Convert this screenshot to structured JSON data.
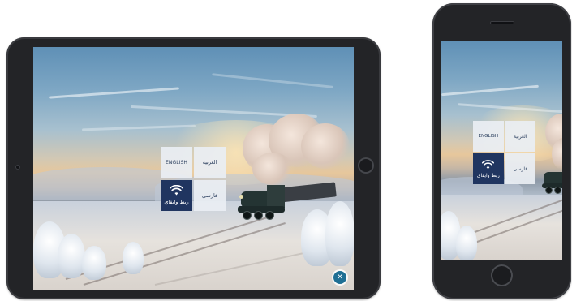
{
  "language_menu": {
    "english_label": "ENGLISH",
    "arabic_label": "العربية",
    "wifi_label": "ربط وايفاي",
    "farsi_label": "فارسی"
  },
  "icons": {
    "wifi": "wifi-icon",
    "close": "close-icon",
    "close_glyph": "✕"
  },
  "colors": {
    "tile_background": "#E9EEF3",
    "tile_text": "#2B3F5E",
    "wifi_tile_background": "#203560",
    "close_button": "#1F6F94",
    "device_frame": "#232427"
  }
}
